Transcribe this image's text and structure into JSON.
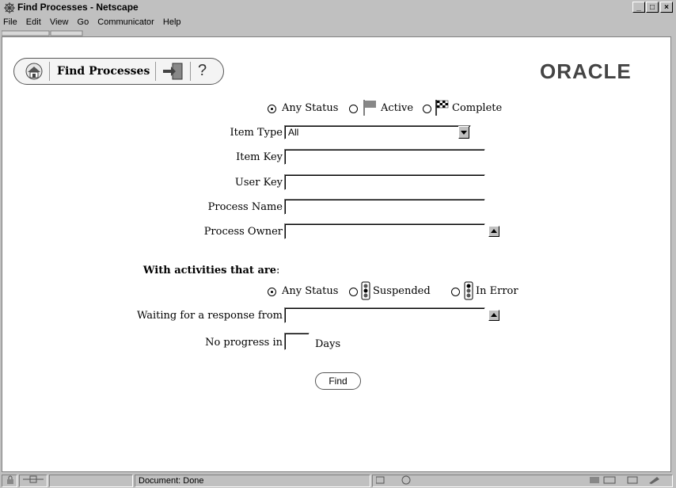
{
  "window": {
    "title": "Find Processes - Netscape",
    "controls": {
      "minimize": "_",
      "maximize": "□",
      "close": "×"
    }
  },
  "menu": [
    "File",
    "Edit",
    "View",
    "Go",
    "Communicator",
    "Help"
  ],
  "toolbar": {
    "title": "Find Processes",
    "help": "?"
  },
  "logo": "ORACLE",
  "status_filter": {
    "options": [
      "Any Status",
      "Active",
      "Complete"
    ],
    "selected": "Any Status"
  },
  "form": {
    "item_type": {
      "label": "Item Type",
      "value": "All"
    },
    "item_key": {
      "label": "Item Key",
      "value": ""
    },
    "user_key": {
      "label": "User Key",
      "value": ""
    },
    "process_name": {
      "label": "Process Name",
      "value": ""
    },
    "process_owner": {
      "label": "Process Owner",
      "value": ""
    }
  },
  "activities": {
    "heading": "With activities that are",
    "colon": ":",
    "options": [
      "Any Status",
      "Suspended",
      "In Error"
    ],
    "selected": "Any Status",
    "waiting_label": "Waiting for a response from",
    "waiting_value": "",
    "no_progress_label": "No progress in",
    "no_progress_value": "",
    "days_label": "Days"
  },
  "find_button": "Find",
  "status_bar": {
    "text": "Document: Done"
  }
}
